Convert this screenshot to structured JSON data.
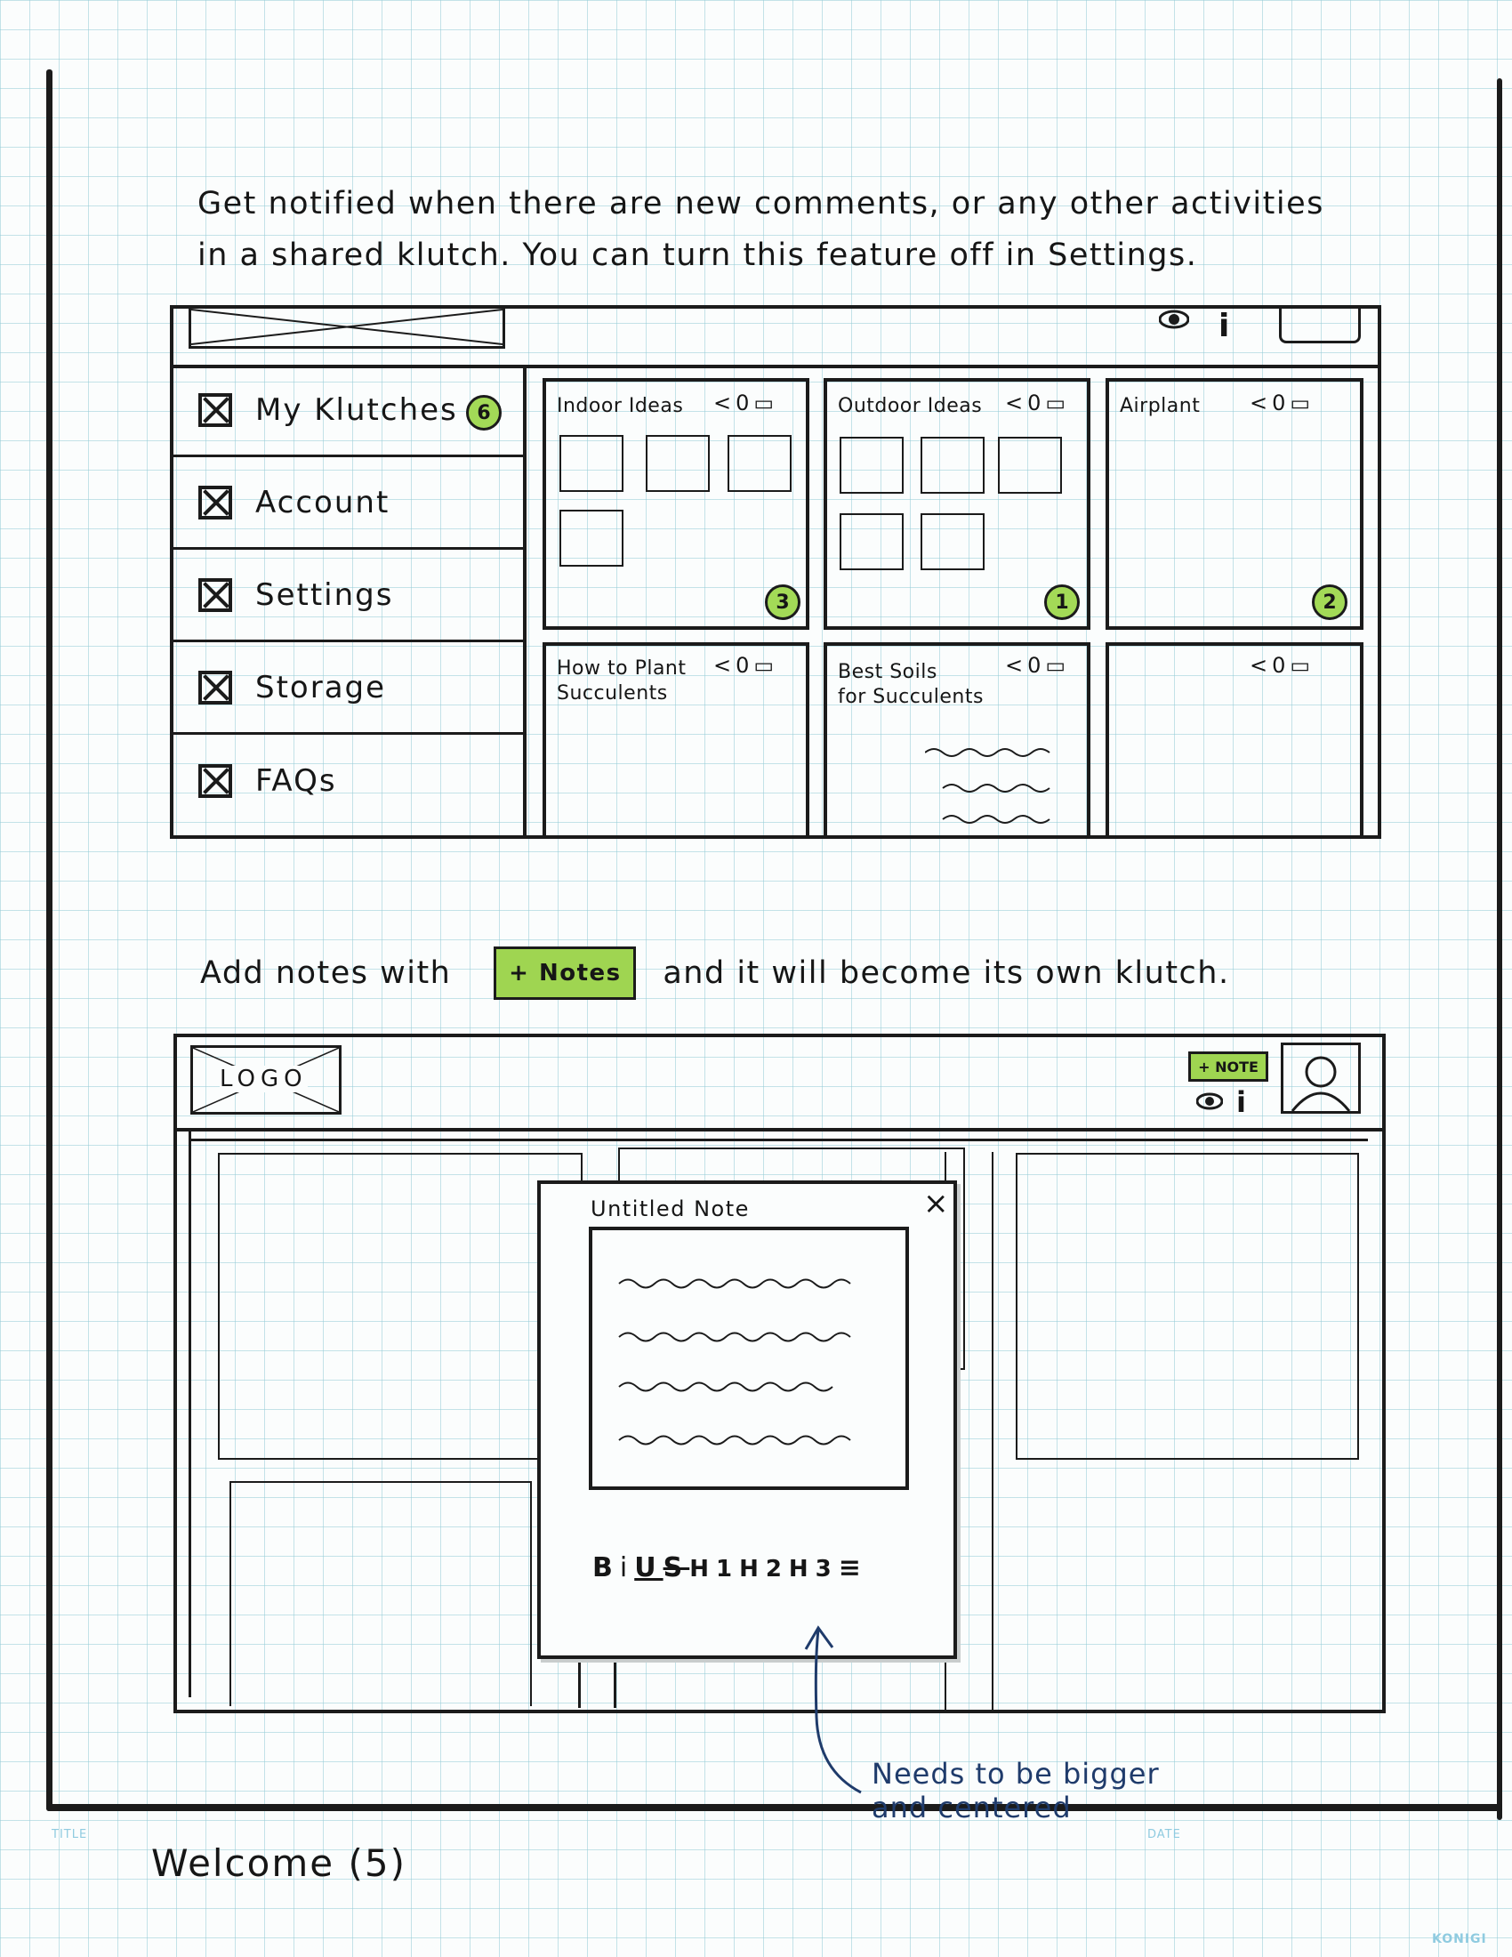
{
  "intro_text": {
    "line1": "Get notified when there are new comments, or any other activities",
    "line2": "in a shared klutch. You can turn this feature off in Settings."
  },
  "screen1": {
    "header": {
      "icons": [
        "eye-icon",
        "info-icon"
      ]
    },
    "sidebar": {
      "items": [
        {
          "label": "My Klutches",
          "badge": "6"
        },
        {
          "label": "Account"
        },
        {
          "label": "Settings"
        },
        {
          "label": "Storage"
        },
        {
          "label": "FAQs"
        }
      ]
    },
    "cards": [
      {
        "title": "Indoor Ideas",
        "count": "0",
        "badge": "3"
      },
      {
        "title": "Outdoor Ideas",
        "count": "0",
        "badge": "1"
      },
      {
        "title": "Airplant",
        "count": "0",
        "badge": "2"
      },
      {
        "title": "How to Plant\nSucculents",
        "count": "0"
      },
      {
        "title": "Best Soils\nfor Succulents",
        "count": "0"
      },
      {
        "title": "",
        "count": "0"
      }
    ]
  },
  "mid_text": {
    "before": "Add notes with",
    "button": "+ Notes",
    "after": "and it will become its own klutch."
  },
  "screen2": {
    "logo": "LOGO",
    "note_button": "+ NOTE",
    "icons": [
      "eye-icon",
      "info-icon",
      "avatar"
    ],
    "note_modal": {
      "title": "Untitled Note",
      "close": "×",
      "toolbar": [
        "B",
        "i",
        "U",
        "S",
        "H1",
        "H2",
        "H3",
        "≡"
      ]
    }
  },
  "annotation": {
    "line1": "Needs to be bigger",
    "line2": "and centered"
  },
  "footer": {
    "title_label": "TITLE",
    "date_label": "DATE",
    "page_title": "Welcome (5)",
    "brand": "KONIGI"
  },
  "colors": {
    "accent_green": "#a3da57",
    "annotation_blue": "#1f3b6b",
    "grid": "#96cdd7"
  }
}
